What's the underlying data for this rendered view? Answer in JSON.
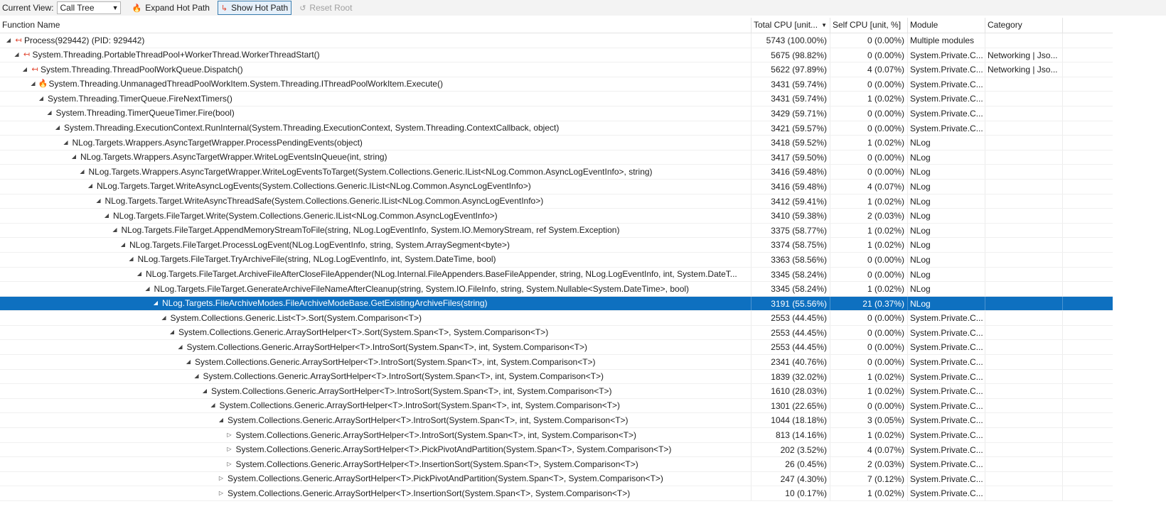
{
  "toolbar": {
    "current_view_label": "Current View:",
    "current_view_value": "Call Tree",
    "expand_hot_path": "Expand Hot Path",
    "show_hot_path": "Show Hot Path",
    "reset_root": "Reset Root"
  },
  "columns": {
    "function_name": "Function Name",
    "total_cpu": "Total CPU [unit...",
    "self_cpu": "Self CPU [unit, %]",
    "module": "Module",
    "category": "Category"
  },
  "rows": [
    {
      "depth": 0,
      "toggle": "expanded",
      "hot": "hot-path-icon",
      "name": "Process(929442) (PID: 929442)",
      "total": "5743 (100.00%)",
      "self": "0 (0.00%)",
      "module": "Multiple modules",
      "category": ""
    },
    {
      "depth": 1,
      "toggle": "expanded",
      "hot": "hot-path-icon",
      "name": "System.Threading.PortableThreadPool+WorkerThread.WorkerThreadStart()",
      "total": "5675 (98.82%)",
      "self": "0 (0.00%)",
      "module": "System.Private.C...",
      "category": "Networking | Jso..."
    },
    {
      "depth": 2,
      "toggle": "expanded",
      "hot": "hot-path-icon",
      "name": "System.Threading.ThreadPoolWorkQueue.Dispatch()",
      "total": "5622 (97.89%)",
      "self": "4 (0.07%)",
      "module": "System.Private.C...",
      "category": "Networking | Jso..."
    },
    {
      "depth": 3,
      "toggle": "expanded",
      "hot": "flame-icon",
      "name": "System.Threading.UnmanagedThreadPoolWorkItem.System.Threading.IThreadPoolWorkItem.Execute()",
      "total": "3431 (59.74%)",
      "self": "0 (0.00%)",
      "module": "System.Private.C...",
      "category": ""
    },
    {
      "depth": 4,
      "toggle": "expanded",
      "hot": "",
      "name": "System.Threading.TimerQueue.FireNextTimers()",
      "total": "3431 (59.74%)",
      "self": "1 (0.02%)",
      "module": "System.Private.C...",
      "category": ""
    },
    {
      "depth": 5,
      "toggle": "expanded",
      "hot": "",
      "name": "System.Threading.TimerQueueTimer.Fire(bool)",
      "total": "3429 (59.71%)",
      "self": "0 (0.00%)",
      "module": "System.Private.C...",
      "category": ""
    },
    {
      "depth": 6,
      "toggle": "expanded",
      "hot": "",
      "name": "System.Threading.ExecutionContext.RunInternal(System.Threading.ExecutionContext, System.Threading.ContextCallback, object)",
      "total": "3421 (59.57%)",
      "self": "0 (0.00%)",
      "module": "System.Private.C...",
      "category": ""
    },
    {
      "depth": 7,
      "toggle": "expanded",
      "hot": "",
      "name": "NLog.Targets.Wrappers.AsyncTargetWrapper.ProcessPendingEvents(object)",
      "total": "3418 (59.52%)",
      "self": "1 (0.02%)",
      "module": "NLog",
      "category": ""
    },
    {
      "depth": 8,
      "toggle": "expanded",
      "hot": "",
      "name": "NLog.Targets.Wrappers.AsyncTargetWrapper.WriteLogEventsInQueue(int, string)",
      "total": "3417 (59.50%)",
      "self": "0 (0.00%)",
      "module": "NLog",
      "category": ""
    },
    {
      "depth": 9,
      "toggle": "expanded",
      "hot": "",
      "name": "NLog.Targets.Wrappers.AsyncTargetWrapper.WriteLogEventsToTarget(System.Collections.Generic.IList<NLog.Common.AsyncLogEventInfo>, string)",
      "total": "3416 (59.48%)",
      "self": "0 (0.00%)",
      "module": "NLog",
      "category": ""
    },
    {
      "depth": 10,
      "toggle": "expanded",
      "hot": "",
      "name": "NLog.Targets.Target.WriteAsyncLogEvents(System.Collections.Generic.IList<NLog.Common.AsyncLogEventInfo>)",
      "total": "3416 (59.48%)",
      "self": "4 (0.07%)",
      "module": "NLog",
      "category": ""
    },
    {
      "depth": 11,
      "toggle": "expanded",
      "hot": "",
      "name": "NLog.Targets.Target.WriteAsyncThreadSafe(System.Collections.Generic.IList<NLog.Common.AsyncLogEventInfo>)",
      "total": "3412 (59.41%)",
      "self": "1 (0.02%)",
      "module": "NLog",
      "category": ""
    },
    {
      "depth": 12,
      "toggle": "expanded",
      "hot": "",
      "name": "NLog.Targets.FileTarget.Write(System.Collections.Generic.IList<NLog.Common.AsyncLogEventInfo>)",
      "total": "3410 (59.38%)",
      "self": "2 (0.03%)",
      "module": "NLog",
      "category": ""
    },
    {
      "depth": 13,
      "toggle": "expanded",
      "hot": "",
      "name": "NLog.Targets.FileTarget.AppendMemoryStreamToFile(string, NLog.LogEventInfo, System.IO.MemoryStream, ref System.Exception)",
      "total": "3375 (58.77%)",
      "self": "1 (0.02%)",
      "module": "NLog",
      "category": ""
    },
    {
      "depth": 14,
      "toggle": "expanded",
      "hot": "",
      "name": "NLog.Targets.FileTarget.ProcessLogEvent(NLog.LogEventInfo, string, System.ArraySegment<byte>)",
      "total": "3374 (58.75%)",
      "self": "1 (0.02%)",
      "module": "NLog",
      "category": ""
    },
    {
      "depth": 15,
      "toggle": "expanded",
      "hot": "",
      "name": "NLog.Targets.FileTarget.TryArchiveFile(string, NLog.LogEventInfo, int, System.DateTime, bool)",
      "total": "3363 (58.56%)",
      "self": "0 (0.00%)",
      "module": "NLog",
      "category": ""
    },
    {
      "depth": 16,
      "toggle": "expanded",
      "hot": "",
      "name": "NLog.Targets.FileTarget.ArchiveFileAfterCloseFileAppender(NLog.Internal.FileAppenders.BaseFileAppender, string, NLog.LogEventInfo, int, System.DateT...",
      "total": "3345 (58.24%)",
      "self": "0 (0.00%)",
      "module": "NLog",
      "category": ""
    },
    {
      "depth": 17,
      "toggle": "expanded",
      "hot": "",
      "name": "NLog.Targets.FileTarget.GenerateArchiveFileNameAfterCleanup(string, System.IO.FileInfo, string, System.Nullable<System.DateTime>, bool)",
      "total": "3345 (58.24%)",
      "self": "1 (0.02%)",
      "module": "NLog",
      "category": ""
    },
    {
      "depth": 18,
      "toggle": "expanded",
      "hot": "",
      "selected": true,
      "name": "NLog.Targets.FileArchiveModes.FileArchiveModeBase.GetExistingArchiveFiles(string)",
      "total": "3191 (55.56%)",
      "self": "21 (0.37%)",
      "module": "NLog",
      "category": ""
    },
    {
      "depth": 19,
      "toggle": "expanded",
      "hot": "",
      "name": "System.Collections.Generic.List<T>.Sort(System.Comparison<T>)",
      "total": "2553 (44.45%)",
      "self": "0 (0.00%)",
      "module": "System.Private.C...",
      "category": ""
    },
    {
      "depth": 20,
      "toggle": "expanded",
      "hot": "",
      "name": "System.Collections.Generic.ArraySortHelper<T>.Sort(System.Span<T>, System.Comparison<T>)",
      "total": "2553 (44.45%)",
      "self": "0 (0.00%)",
      "module": "System.Private.C...",
      "category": ""
    },
    {
      "depth": 21,
      "toggle": "expanded",
      "hot": "",
      "name": "System.Collections.Generic.ArraySortHelper<T>.IntroSort(System.Span<T>, int, System.Comparison<T>)",
      "total": "2553 (44.45%)",
      "self": "0 (0.00%)",
      "module": "System.Private.C...",
      "category": ""
    },
    {
      "depth": 22,
      "toggle": "expanded",
      "hot": "",
      "name": "System.Collections.Generic.ArraySortHelper<T>.IntroSort(System.Span<T>, int, System.Comparison<T>)",
      "total": "2341 (40.76%)",
      "self": "0 (0.00%)",
      "module": "System.Private.C...",
      "category": ""
    },
    {
      "depth": 23,
      "toggle": "expanded",
      "hot": "",
      "name": "System.Collections.Generic.ArraySortHelper<T>.IntroSort(System.Span<T>, int, System.Comparison<T>)",
      "total": "1839 (32.02%)",
      "self": "1 (0.02%)",
      "module": "System.Private.C...",
      "category": ""
    },
    {
      "depth": 24,
      "toggle": "expanded",
      "hot": "",
      "name": "System.Collections.Generic.ArraySortHelper<T>.IntroSort(System.Span<T>, int, System.Comparison<T>)",
      "total": "1610 (28.03%)",
      "self": "1 (0.02%)",
      "module": "System.Private.C...",
      "category": ""
    },
    {
      "depth": 25,
      "toggle": "expanded",
      "hot": "",
      "name": "System.Collections.Generic.ArraySortHelper<T>.IntroSort(System.Span<T>, int, System.Comparison<T>)",
      "total": "1301 (22.65%)",
      "self": "0 (0.00%)",
      "module": "System.Private.C...",
      "category": ""
    },
    {
      "depth": 26,
      "toggle": "expanded",
      "hot": "",
      "name": "System.Collections.Generic.ArraySortHelper<T>.IntroSort(System.Span<T>, int, System.Comparison<T>)",
      "total": "1044 (18.18%)",
      "self": "3 (0.05%)",
      "module": "System.Private.C...",
      "category": ""
    },
    {
      "depth": 27,
      "toggle": "collapsed",
      "hot": "",
      "name": "System.Collections.Generic.ArraySortHelper<T>.IntroSort(System.Span<T>, int, System.Comparison<T>)",
      "total": "813 (14.16%)",
      "self": "1 (0.02%)",
      "module": "System.Private.C...",
      "category": ""
    },
    {
      "depth": 27,
      "toggle": "collapsed",
      "hot": "",
      "name": "System.Collections.Generic.ArraySortHelper<T>.PickPivotAndPartition(System.Span<T>, System.Comparison<T>)",
      "total": "202 (3.52%)",
      "self": "4 (0.07%)",
      "module": "System.Private.C...",
      "category": ""
    },
    {
      "depth": 27,
      "toggle": "collapsed",
      "hot": "",
      "name": "System.Collections.Generic.ArraySortHelper<T>.InsertionSort(System.Span<T>, System.Comparison<T>)",
      "total": "26 (0.45%)",
      "self": "2 (0.03%)",
      "module": "System.Private.C...",
      "category": ""
    },
    {
      "depth": 26,
      "toggle": "collapsed",
      "hot": "",
      "name": "System.Collections.Generic.ArraySortHelper<T>.PickPivotAndPartition(System.Span<T>, System.Comparison<T>)",
      "total": "247 (4.30%)",
      "self": "7 (0.12%)",
      "module": "System.Private.C...",
      "category": ""
    },
    {
      "depth": 26,
      "toggle": "collapsed",
      "hot": "",
      "name": "System.Collections.Generic.ArraySortHelper<T>.InsertionSort(System.Span<T>, System.Comparison<T>)",
      "total": "10 (0.17%)",
      "self": "1 (0.02%)",
      "module": "System.Private.C...",
      "category": ""
    }
  ]
}
